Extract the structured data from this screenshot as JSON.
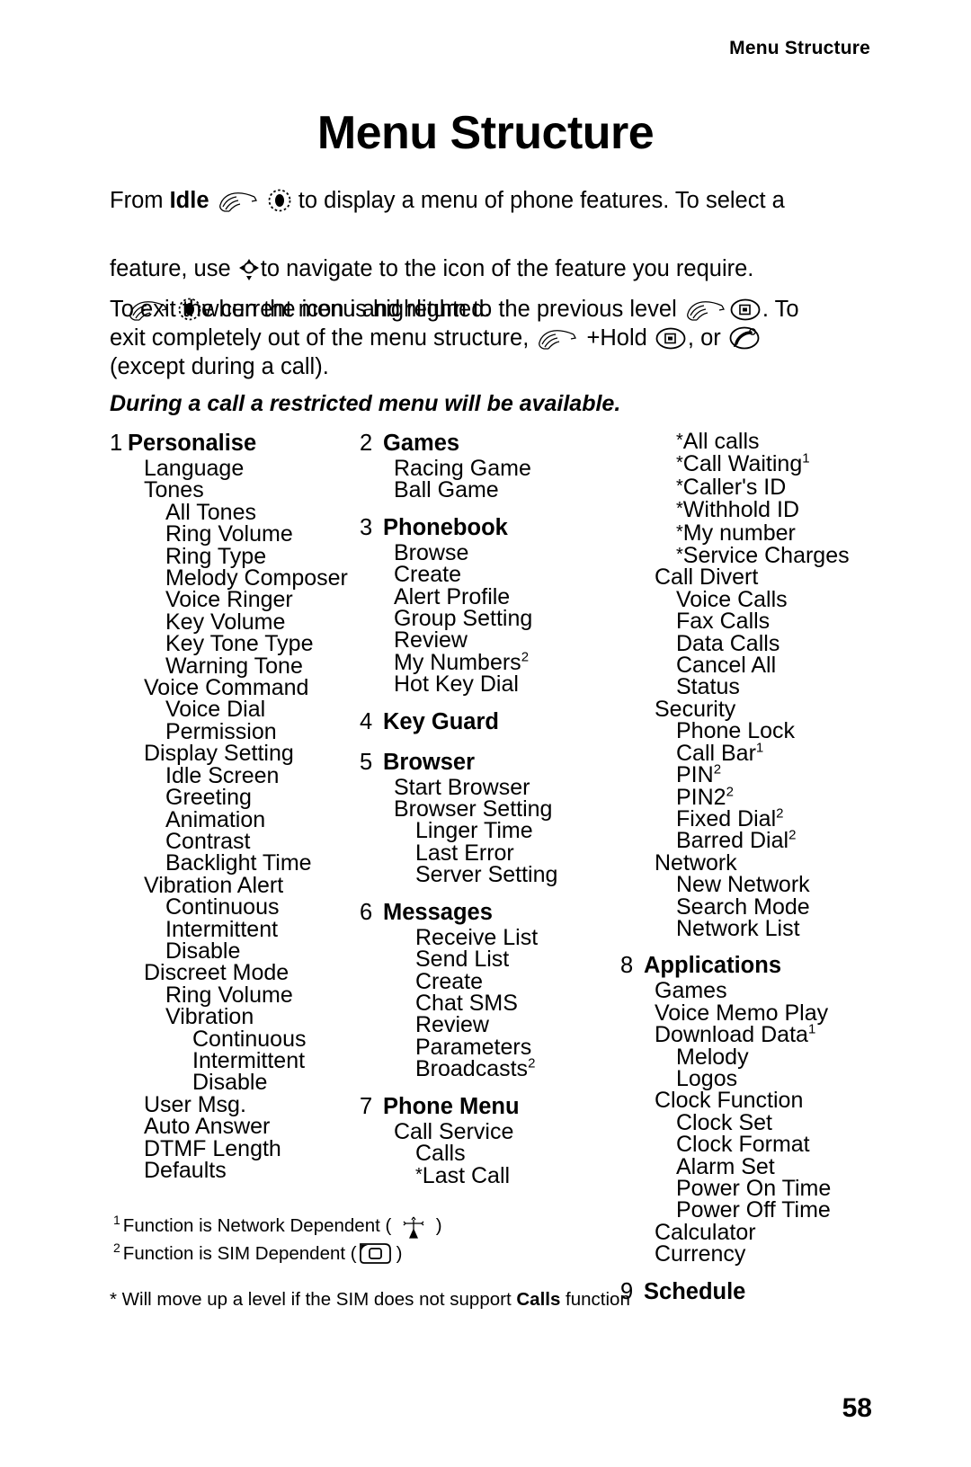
{
  "header": {
    "running_title": "Menu Structure",
    "page_title": "Menu Structure",
    "page_number": "58"
  },
  "intro": {
    "line1_a": "From ",
    "line1_idle": "Idle",
    "line1_b": " to display a menu of phone features. To select a",
    "line2_a": "feature, use ",
    "line2_b": "to navigate to the icon of the  feature  you require.",
    "line3": "when the icon is highlighted.",
    "para2_a": "To exit the current menu and return to the previous level ",
    "para2_b": ". To",
    "para2_c": "exit completely out of the menu structure, ",
    "para2_hold": "+Hold ",
    "para2_d": ", or ",
    "para2_e": "(except during a call).",
    "restricted_note": "During a call a restricted menu will be available."
  },
  "icons": {
    "hand": "hand-press-icon",
    "select_key": "select-key-icon",
    "nav_key": "navigation-key-icon",
    "soft_key": "soft-key-icon",
    "end_key": "end-call-key-icon",
    "antenna": "antenna-icon",
    "sim": "sim-card-icon"
  },
  "menu": {
    "column1": [
      {
        "number": "1",
        "title": "Personalise",
        "items": [
          {
            "label": "Language",
            "level": 1
          },
          {
            "label": "Tones",
            "level": 1
          },
          {
            "label": "All Tones",
            "level": 2
          },
          {
            "label": "Ring Volume",
            "level": 2
          },
          {
            "label": "Ring Type",
            "level": 2
          },
          {
            "label": "Melody Composer",
            "level": 2
          },
          {
            "label": "Voice Ringer",
            "level": 2
          },
          {
            "label": "Key Volume",
            "level": 2
          },
          {
            "label": "Key Tone Type",
            "level": 2
          },
          {
            "label": "Warning Tone",
            "level": 2
          },
          {
            "label": "Voice Command",
            "level": 1
          },
          {
            "label": "Voice Dial",
            "level": 2
          },
          {
            "label": "Permission",
            "level": 2
          },
          {
            "label": "Display Setting",
            "level": 1
          },
          {
            "label": "Idle Screen",
            "level": 2
          },
          {
            "label": "Greeting",
            "level": 2
          },
          {
            "label": "Animation",
            "level": 2
          },
          {
            "label": "Contrast",
            "level": 2
          },
          {
            "label": "Backlight Time",
            "level": 2
          },
          {
            "label": "Vibration Alert",
            "level": 1
          },
          {
            "label": "Continuous",
            "level": 2
          },
          {
            "label": "Intermittent",
            "level": 2
          },
          {
            "label": "Disable",
            "level": 2
          },
          {
            "label": "Discreet Mode",
            "level": 1
          },
          {
            "label": "Ring Volume",
            "level": 2
          },
          {
            "label": "Vibration",
            "level": 2
          },
          {
            "label": "Continuous",
            "level": 3
          },
          {
            "label": "Intermittent",
            "level": 3
          },
          {
            "label": "Disable",
            "level": 3
          },
          {
            "label": "User Msg.",
            "level": 1
          },
          {
            "label": "Auto Answer",
            "level": 1
          },
          {
            "label": "DTMF Length",
            "level": 1
          },
          {
            "label": "Defaults",
            "level": 1
          }
        ]
      }
    ],
    "column2": [
      {
        "number": "2",
        "title": "Games",
        "items": [
          {
            "label": "Racing Game",
            "level": 1
          },
          {
            "label": "Ball Game",
            "level": 1
          }
        ]
      },
      {
        "number": "3",
        "title": "Phonebook",
        "items": [
          {
            "label": "Browse",
            "level": 1
          },
          {
            "label": "Create",
            "level": 1
          },
          {
            "label": "Alert Profile",
            "level": 1
          },
          {
            "label": "Group Setting",
            "level": 1
          },
          {
            "label": "Review",
            "level": 1
          },
          {
            "label": "My Numbers",
            "level": 1,
            "footnote": "2"
          },
          {
            "label": "Hot Key Dial",
            "level": 1
          }
        ]
      },
      {
        "number": "4",
        "title": "Key Guard",
        "items": []
      },
      {
        "number": "5",
        "title": "Browser",
        "items": [
          {
            "label": "Start Browser",
            "level": 1
          },
          {
            "label": "Browser Setting",
            "level": 1
          },
          {
            "label": "Linger Time",
            "level": 2
          },
          {
            "label": "Last Error",
            "level": 2
          },
          {
            "label": "Server Setting",
            "level": 2
          }
        ]
      },
      {
        "number": "6",
        "title": "Messages",
        "items": [
          {
            "label": "Receive List",
            "level": 2
          },
          {
            "label": "Send List",
            "level": 2
          },
          {
            "label": "Create",
            "level": 2
          },
          {
            "label": "Chat SMS",
            "level": 2
          },
          {
            "label": "Review",
            "level": 2
          },
          {
            "label": "Parameters",
            "level": 2
          },
          {
            "label": "Broadcasts",
            "level": 2,
            "footnote": "2"
          }
        ]
      },
      {
        "number": "7",
        "title": "Phone Menu",
        "items": [
          {
            "label": "Call Service",
            "level": 1
          },
          {
            "label": "Calls",
            "level": 2
          },
          {
            "label": "Last Call",
            "level": 2,
            "asterisk": true
          }
        ]
      }
    ],
    "column3_continued": [
      {
        "label": "All calls",
        "level": 2,
        "asterisk": true
      },
      {
        "label": "Call Waiting",
        "level": 2,
        "asterisk": true,
        "footnote": "1"
      },
      {
        "label": "Caller's ID",
        "level": 2,
        "asterisk": true
      },
      {
        "label": "Withhold ID",
        "level": 2,
        "asterisk": true
      },
      {
        "label": "My number",
        "level": 2,
        "asterisk": true
      },
      {
        "label": "Service Charges",
        "level": 2,
        "asterisk": true
      },
      {
        "label": "Call Divert",
        "level": 1
      },
      {
        "label": "Voice Calls",
        "level": 2
      },
      {
        "label": "Fax Calls",
        "level": 2
      },
      {
        "label": "Data Calls",
        "level": 2
      },
      {
        "label": "Cancel All",
        "level": 2
      },
      {
        "label": "Status",
        "level": 2
      },
      {
        "label": "Security",
        "level": 1
      },
      {
        "label": "Phone Lock",
        "level": 2
      },
      {
        "label": "Call Bar",
        "level": 2,
        "footnote": "1"
      },
      {
        "label": "PIN",
        "level": 2,
        "footnote": "2"
      },
      {
        "label": "PIN2",
        "level": 2,
        "footnote": "2"
      },
      {
        "label": "Fixed Dial",
        "level": 2,
        "footnote": "2"
      },
      {
        "label": "Barred Dial",
        "level": 2,
        "footnote": "2"
      },
      {
        "label": "Network",
        "level": 1
      },
      {
        "label": "New Network",
        "level": 2
      },
      {
        "label": "Search Mode",
        "level": 2
      },
      {
        "label": "Network List",
        "level": 2
      }
    ],
    "column3": [
      {
        "number": "8",
        "title": "Applications",
        "items": [
          {
            "label": "Games",
            "level": 1
          },
          {
            "label": "Voice Memo Play",
            "level": 1
          },
          {
            "label": "Download Data",
            "level": 1,
            "footnote": "1"
          },
          {
            "label": "Melody",
            "level": 2
          },
          {
            "label": "Logos",
            "level": 2
          },
          {
            "label": "Clock Function",
            "level": 1
          },
          {
            "label": "Clock Set",
            "level": 2
          },
          {
            "label": "Clock Format",
            "level": 2
          },
          {
            "label": "Alarm Set",
            "level": 2
          },
          {
            "label": "Power On Time",
            "level": 2
          },
          {
            "label": "Power Off Time",
            "level": 2
          },
          {
            "label": "Calculator",
            "level": 1
          },
          {
            "label": "Currency",
            "level": 1
          }
        ]
      },
      {
        "number": "9",
        "title": "Schedule",
        "items": []
      }
    ]
  },
  "footnotes": {
    "fn1_marker": "1",
    "fn1_a": "Function is Network Dependent ( ",
    "fn1_b": " )",
    "fn2_marker": "2",
    "fn2_a": "Function is SIM Dependent (",
    "fn2_b": ")",
    "star_a": "* Will move up a level if the SIM does not support ",
    "star_bold": "Calls",
    "star_b": " function"
  }
}
